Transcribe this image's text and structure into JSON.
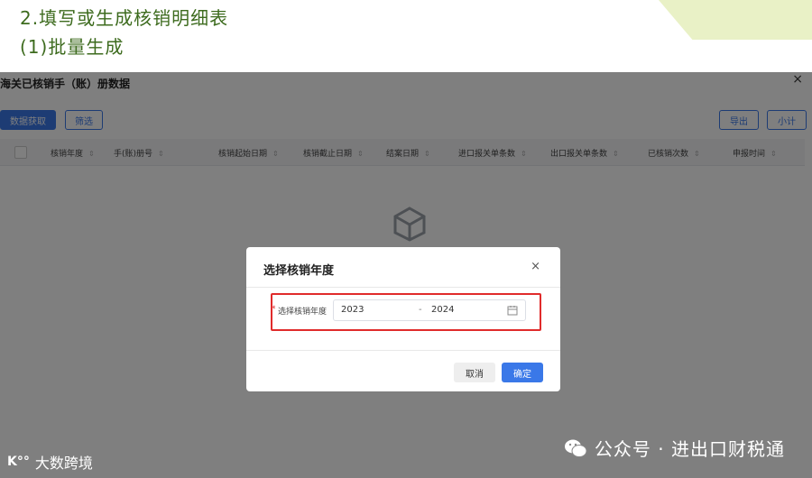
{
  "slide": {
    "title": "2.填写或生成核销明细表",
    "subtitle": "(1)批量生成"
  },
  "app": {
    "title": "海关已核销手（账）册数据",
    "close": "×",
    "buttons": {
      "fetch": "数据获取",
      "filter": "筛选",
      "export": "导出",
      "subtotal": "小计"
    },
    "columns": [
      "核销年度",
      "手(账)册号",
      "核销起始日期",
      "核销截止日期",
      "结案日期",
      "进口报关单条数",
      "出口报关单条数",
      "已核销次数",
      "申报时间"
    ]
  },
  "dialog": {
    "title": "选择核销年度",
    "close": "×",
    "required_mark": "*",
    "field_label": "选择核销年度",
    "start_year": "2023",
    "separator": "-",
    "end_year": "2024",
    "cancel": "取消",
    "ok": "确定"
  },
  "watermarks": {
    "wechat": "公众号 · 进出口财税通",
    "brand_icon": "K°°",
    "brand": "大数跨境"
  },
  "colors": {
    "accent": "#3a78e8",
    "highlight": "#e02b2b",
    "title_green": "#3d6b1e"
  }
}
